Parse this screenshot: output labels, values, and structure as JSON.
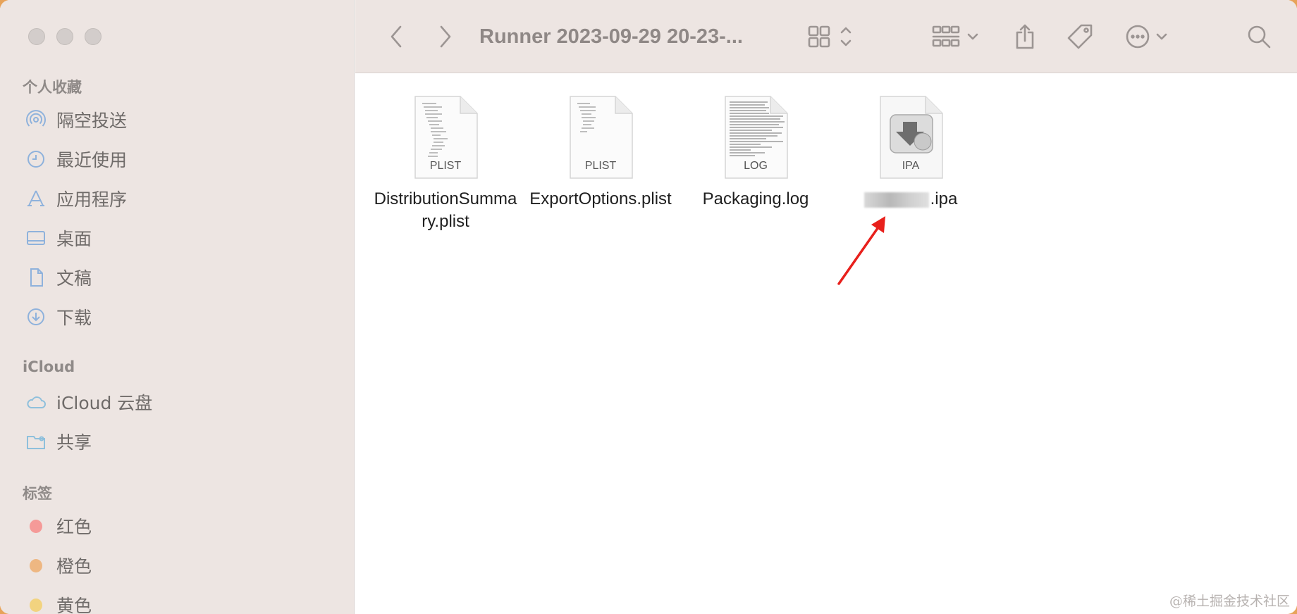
{
  "window": {
    "title": "Runner 2023-09-29 20-23-..."
  },
  "sidebar": {
    "favorites_title": "个人收藏",
    "favorites": [
      {
        "label": "隔空投送",
        "icon": "airdrop-icon"
      },
      {
        "label": "最近使用",
        "icon": "clock-icon"
      },
      {
        "label": "应用程序",
        "icon": "applications-icon"
      },
      {
        "label": "桌面",
        "icon": "desktop-icon"
      },
      {
        "label": "文稿",
        "icon": "document-icon"
      },
      {
        "label": "下载",
        "icon": "download-icon"
      }
    ],
    "icloud_title": "iCloud",
    "icloud": [
      {
        "label": "iCloud 云盘",
        "icon": "cloud-icon"
      },
      {
        "label": "共享",
        "icon": "shared-folder-icon"
      }
    ],
    "tags_title": "标签",
    "tags": [
      {
        "label": "红色",
        "color": "#f59a98"
      },
      {
        "label": "橙色",
        "color": "#eeb782"
      },
      {
        "label": "黄色",
        "color": "#f2d37f"
      }
    ]
  },
  "files": [
    {
      "name": "DistributionSummary.plist",
      "ext": "PLIST"
    },
    {
      "name": "ExportOptions.plist",
      "ext": "PLIST"
    },
    {
      "name": "Packaging.log",
      "ext": "LOG"
    },
    {
      "name": ".ipa",
      "ext": "IPA"
    }
  ],
  "watermark": "@稀土掘金技术社区"
}
